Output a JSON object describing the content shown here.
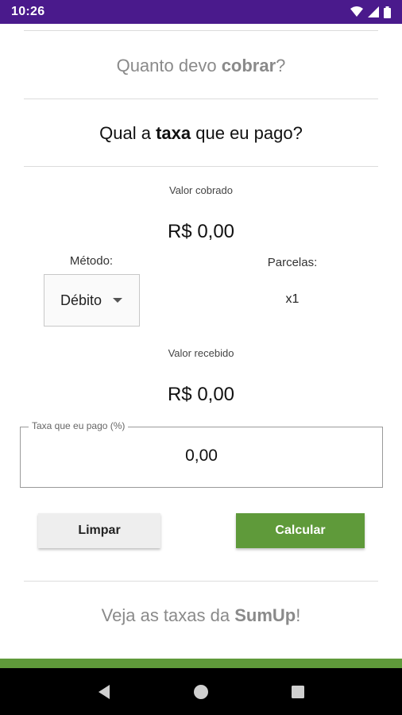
{
  "status_bar": {
    "time": "10:26"
  },
  "menu": {
    "quanto": {
      "prefix": "Quanto devo ",
      "bold": "cobrar",
      "suffix": "?"
    },
    "taxa": {
      "prefix": "Qual a ",
      "bold": "taxa",
      "suffix": " que eu pago?"
    },
    "sumup": {
      "prefix": "Veja as taxas da ",
      "bold": "SumUp",
      "suffix": "!"
    }
  },
  "form": {
    "valor_cobrado_label": "Valor cobrado",
    "valor_cobrado": "R$ 0,00",
    "metodo_label": "Método:",
    "metodo_value": "Débito",
    "parcelas_label": "Parcelas:",
    "parcelas_value": "x1",
    "valor_recebido_label": "Valor recebido",
    "valor_recebido": "R$ 0,00",
    "taxa_label": "Taxa que eu pago (%)",
    "taxa_value": "0,00"
  },
  "buttons": {
    "limpar": "Limpar",
    "calcular": "Calcular"
  },
  "colors": {
    "status_bar": "#4a1a8c",
    "accent_green": "#5f9a3a",
    "nav_bar": "#000000"
  },
  "icons": {
    "status": [
      "wifi-icon",
      "signal-icon",
      "battery-icon"
    ],
    "nav": [
      "back-icon",
      "home-icon",
      "recents-icon"
    ]
  }
}
